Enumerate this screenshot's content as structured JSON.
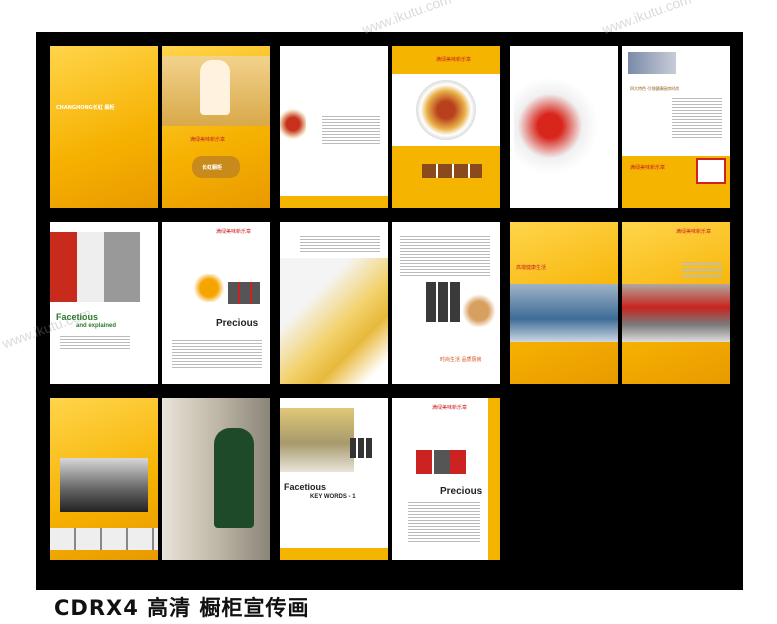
{
  "caption": "CDRX4 高清 橱柜宣传画",
  "watermark": "www.ikutu.com",
  "brand": "CHANGHONG长虹 橱柜",
  "slogan": "满绿美味新乐章",
  "badge": "长虹橱柜",
  "facetious": "Facetious",
  "and_explained": "and explained",
  "precious": "Precious",
  "key_words": "KEY WORDS - 1",
  "kitchen_tag": "高端健康生活",
  "health_tag": "四大特色 引领健康厨房时尚",
  "fashion_tag": "时尚生活 品质厨房"
}
